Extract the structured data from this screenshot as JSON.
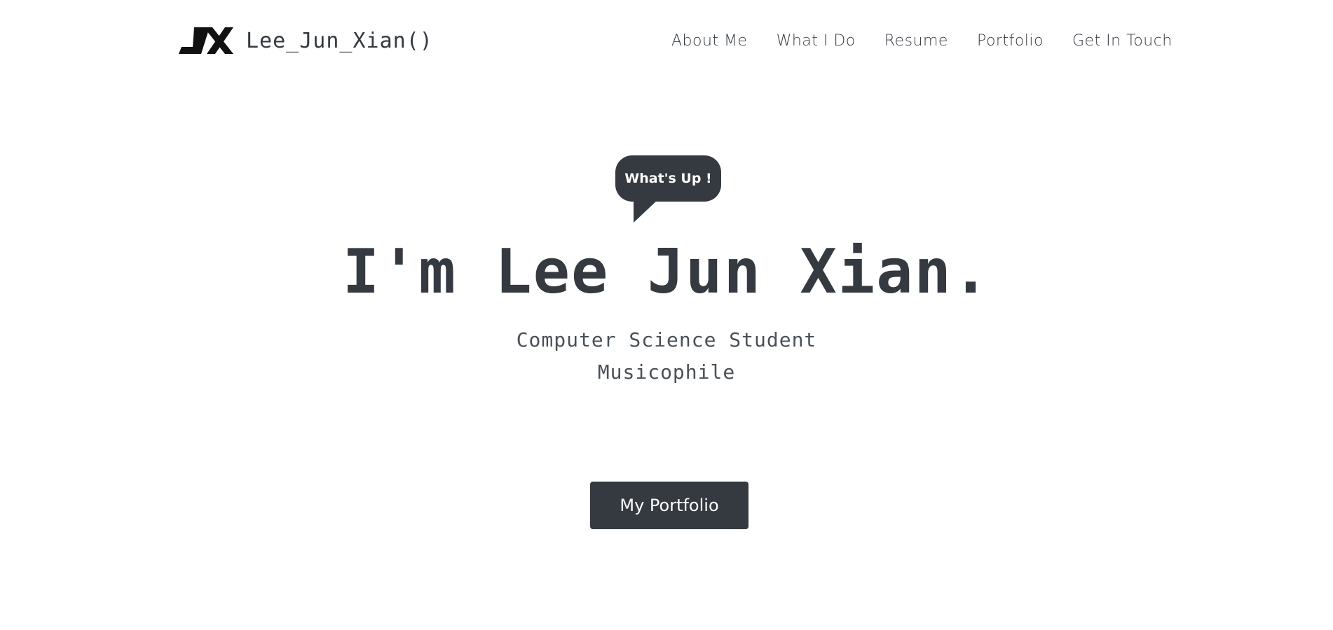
{
  "header": {
    "brand": {
      "logo_icon": "jx-logo-icon",
      "name": "Lee_Jun_Xian()"
    },
    "nav": [
      {
        "label": "About Me"
      },
      {
        "label": "What I Do"
      },
      {
        "label": "Resume"
      },
      {
        "label": "Portfolio"
      },
      {
        "label": "Get In Touch"
      }
    ]
  },
  "hero": {
    "bubble": "What's Up !",
    "title": "I'm Lee Jun Xian.",
    "subtitles": [
      "Computer Science Student",
      "Musicophile"
    ],
    "cta_label": "My Portfolio"
  },
  "colors": {
    "primary": "#343a40",
    "background": "#ffffff",
    "on_primary": "#ffffff"
  }
}
